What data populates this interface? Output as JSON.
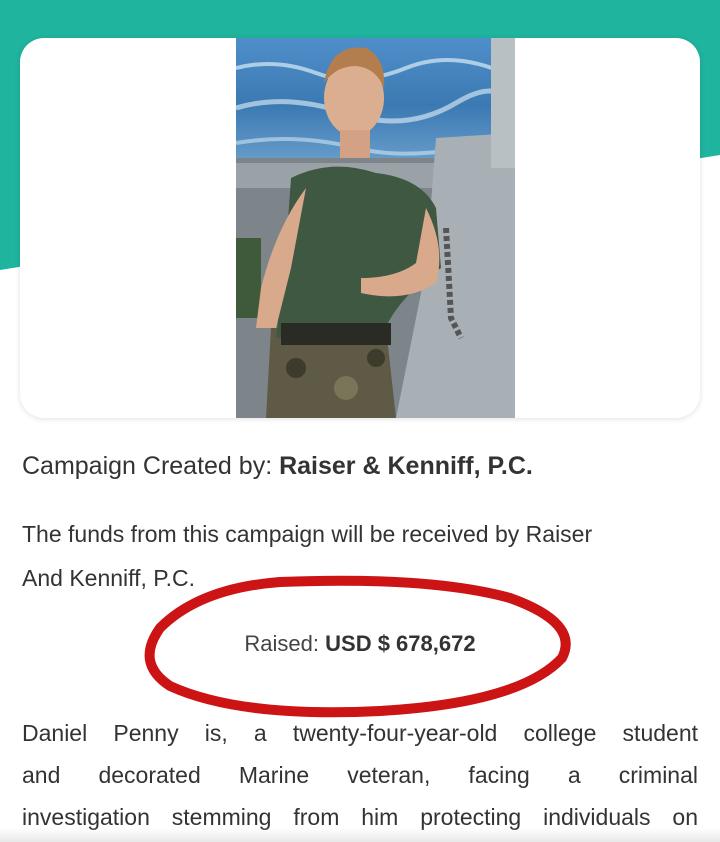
{
  "colors": {
    "teal": "#1fb49e",
    "ellipse_red": "#cc1414",
    "text": "#333333"
  },
  "campaign": {
    "created_by_prefix": "Campaign Created by: ",
    "created_by_name": "Raiser & Kenniff, P.C.",
    "funds_line1": "The funds from this campaign will be received by Raiser",
    "funds_line2": "And Kenniff, P.C.",
    "raised_label": "Raised: ",
    "raised_amount": "USD $ 678,672",
    "description_lines": [
      "Daniel Penny is, a twenty-four-year-old college student",
      "and decorated Marine veteran, facing a criminal",
      "investigation stemming from him protecting individuals on"
    ]
  }
}
